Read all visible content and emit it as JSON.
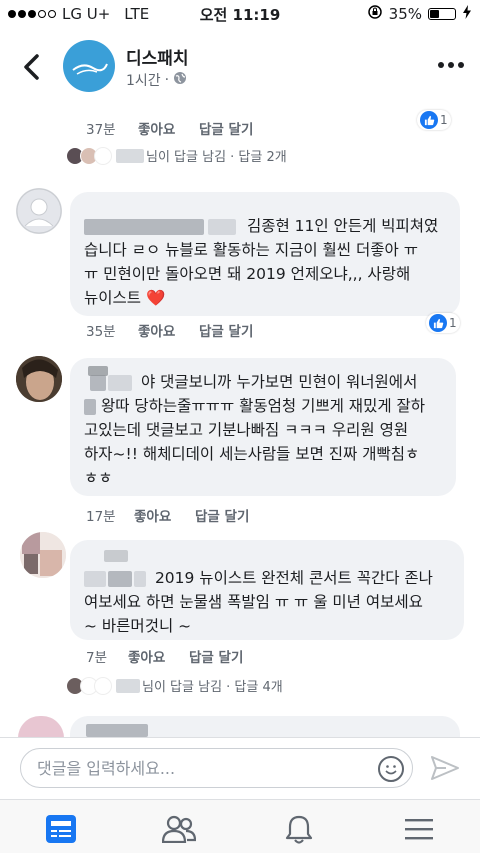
{
  "status_bar": {
    "carrier": "LG U+",
    "network": "LTE",
    "time": "오전 11:19",
    "battery": "35%",
    "battery_level": 0.35
  },
  "header": {
    "page_name": "디스패치",
    "time": "1시간",
    "avatar_text": "새로운 뉴스 디스패치"
  },
  "comments": [
    {
      "time": "37분",
      "like": "좋아요",
      "reply": "답글 달기",
      "like_count": "1",
      "reply_summary": "님이 답글 남김 · 답글 2개"
    },
    {
      "text_line1": "김종현 11인 안든게 빅피쳐였",
      "text_line2": "습니다 ㄹㅇ 뉴블로 활동하는 지금이 훨씬 더좋아 ㅠ",
      "text_line3": "ㅠ 민현이만 돌아오면 돼 2019 언제오냐,,, 사랑해",
      "text_line4": "뉴이스트",
      "emoji": "❤️",
      "time": "35분",
      "like": "좋아요",
      "reply": "답글 달기",
      "like_count": "1"
    },
    {
      "text_line1": "야 댓글보니까 누가보면 민현이 워너원에서",
      "text_line2": "왕따 당하는줄ㅠㅠㅠ 활동엄청 기쁘게 재밌게 잘하",
      "text_line3": "고있는데 댓글보고 기분나빠짐 ㅋㅋㅋ 우리원 영원",
      "text_line4": "하자~!! 해체디데이 세는사람들 보면 진짜 개빡침ㅎ",
      "text_line5": "ㅎㅎ",
      "time": "17분",
      "like": "좋아요",
      "reply": "답글 달기"
    },
    {
      "text_line1": "2019 뉴이스트 완전체 콘서트 꼭간다 존나",
      "text_line2": "여보세요 하면 눈물샘 폭발임 ㅠ ㅠ 울 미년 여보세요",
      "text_line3": "~ 바른머것니 ~",
      "time": "7분",
      "like": "좋아요",
      "reply": "답글 달기",
      "reply_summary": "님이 답글 남김 · 답글 4개"
    }
  ],
  "composer": {
    "placeholder": "댓글을 입력하세요..."
  },
  "tabs": [
    "news-feed",
    "friends",
    "notifications",
    "menu"
  ]
}
